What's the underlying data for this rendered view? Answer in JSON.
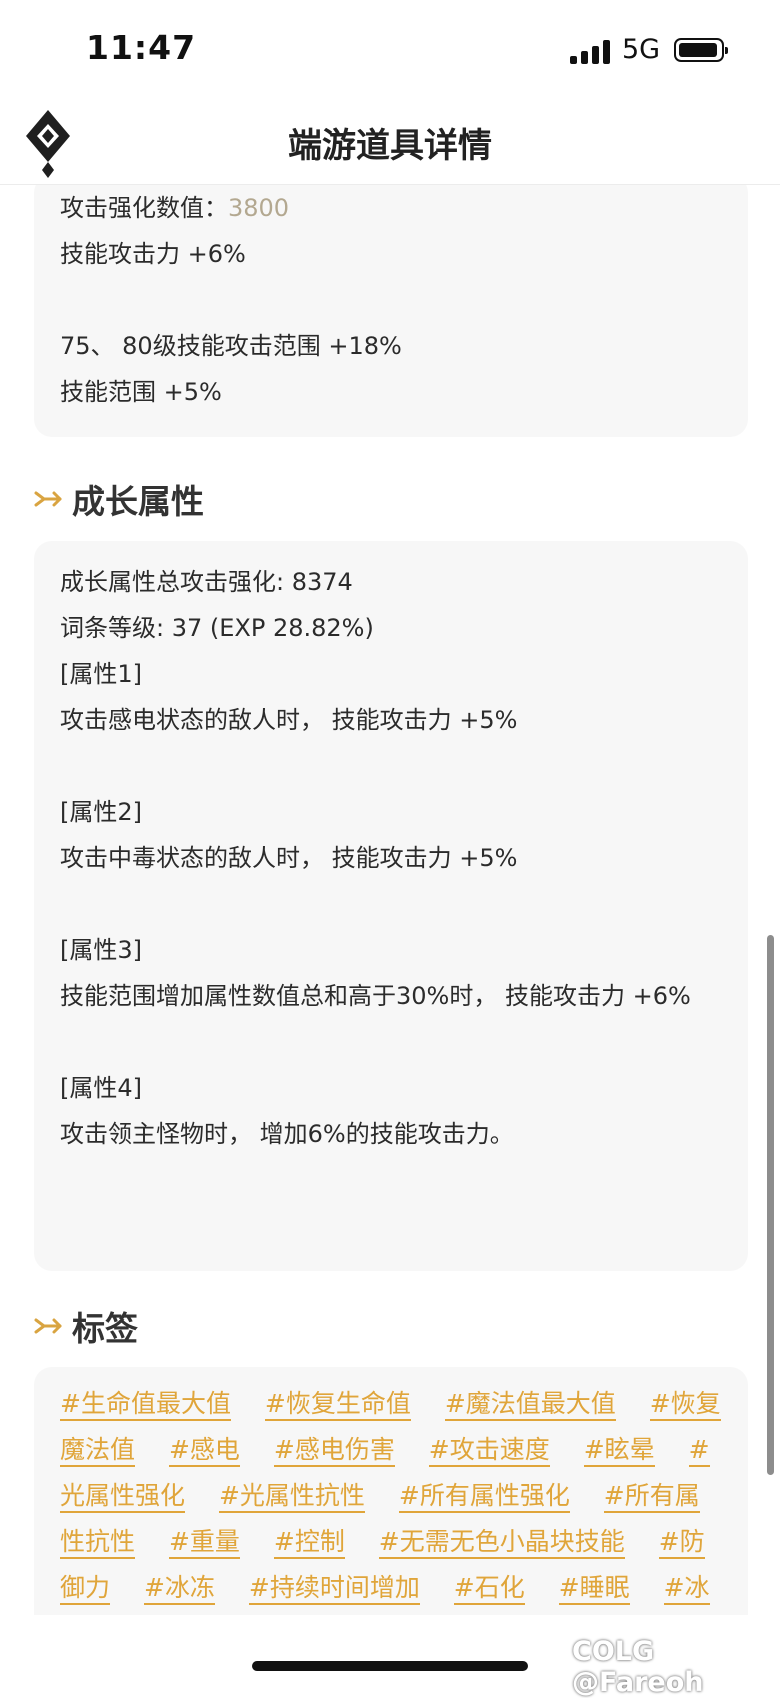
{
  "status": {
    "time": "11:47",
    "network": "5G"
  },
  "nav": {
    "title": "端游道具详情"
  },
  "card1": {
    "line1_label": "攻击强化数值：",
    "line1_value": "3800",
    "line2": "技能攻击力 +6%",
    "line3": "75、 80级技能攻击范围 +18%",
    "line4": "技能范围 +5%"
  },
  "growth": {
    "title": "成长属性",
    "total": "成长属性总攻击强化: 8374",
    "level": "词条等级: 37 (EXP 28.82%)",
    "attr1_label": "[属性1]",
    "attr1": "攻击感电状态的敌人时， 技能攻击力 +5%",
    "attr2_label": "[属性2]",
    "attr2": "攻击中毒状态的敌人时， 技能攻击力 +5%",
    "attr3_label": "[属性3]",
    "attr3": "技能范围增加属性数值总和高于30%时， 技能攻击力 +6%",
    "attr4_label": "[属性4]",
    "attr4": "攻击领主怪物时， 增加6%的技能攻击力。"
  },
  "tags": {
    "title": "标签",
    "items": [
      "#生命值最大值",
      "#恢复生命值",
      "#魔法值最大值",
      "#恢复魔法值",
      "#感电",
      "#感电伤害",
      "#攻击速度",
      "#眩晕",
      "#光属性强化",
      "#光属性抗性",
      "#所有属性强化",
      "#所有属性抗性",
      "#重量",
      "#控制",
      "#无需无色小晶块技能",
      "#防御力",
      "#冰冻",
      "#持续时间增加",
      "#石化",
      "#睡眠",
      "#冰属性"
    ]
  },
  "watermark": "COLG @Fareoh",
  "colors": {
    "accent": "#e0a53a",
    "card_bg": "#f7f7f7",
    "muted": "#b3a890"
  },
  "icons": {
    "logo": "diamond-logo-icon",
    "section": "arrow-right-icon"
  }
}
